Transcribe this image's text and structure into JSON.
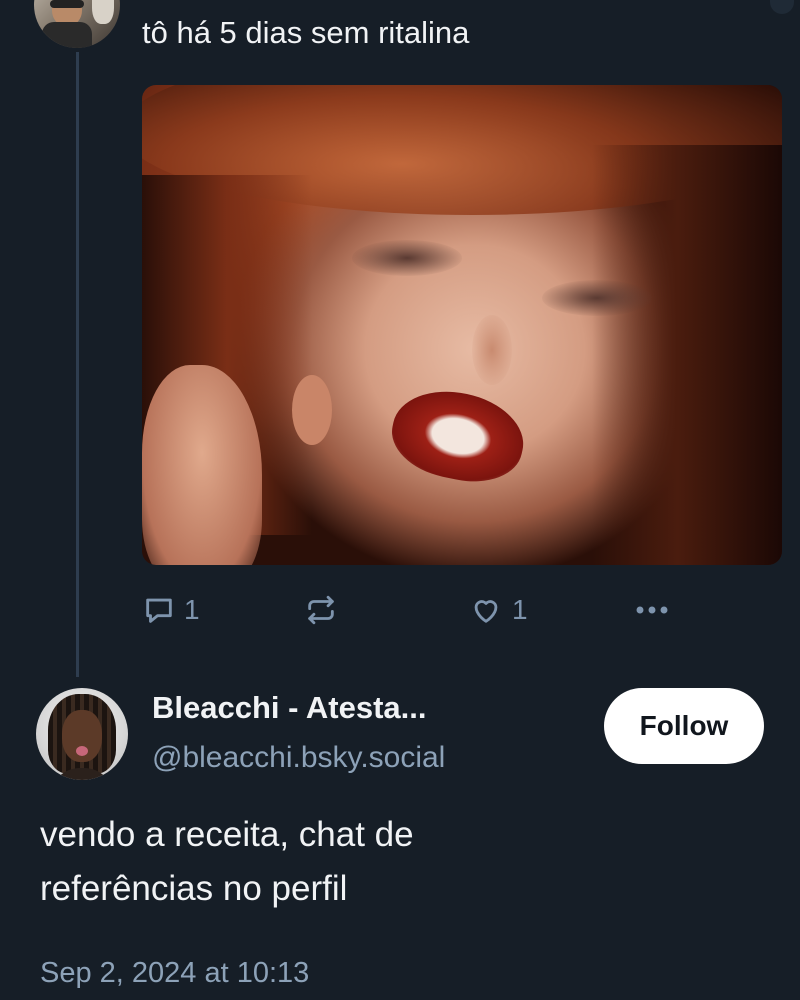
{
  "parent_post": {
    "text": "tô há 5 dias sem ritalina",
    "actions": {
      "reply_count": "1",
      "like_count": "1"
    }
  },
  "main_post": {
    "display_name": "Bleacchi - Atesta...",
    "handle": "@bleacchi.bsky.social",
    "follow_label": "Follow",
    "text_line_1": "vendo a receita, chat de",
    "text_line_2": "referências no perfil",
    "timestamp": "Sep 2, 2024 at 10:13"
  },
  "colors": {
    "background": "#161e27",
    "muted_text": "#8da2b8",
    "icon": "#7e94ad",
    "thread_line": "#2e3d4f",
    "follow_bg": "#ffffff"
  },
  "icons": [
    "reply-icon",
    "repost-icon",
    "like-icon",
    "more-options-icon"
  ]
}
